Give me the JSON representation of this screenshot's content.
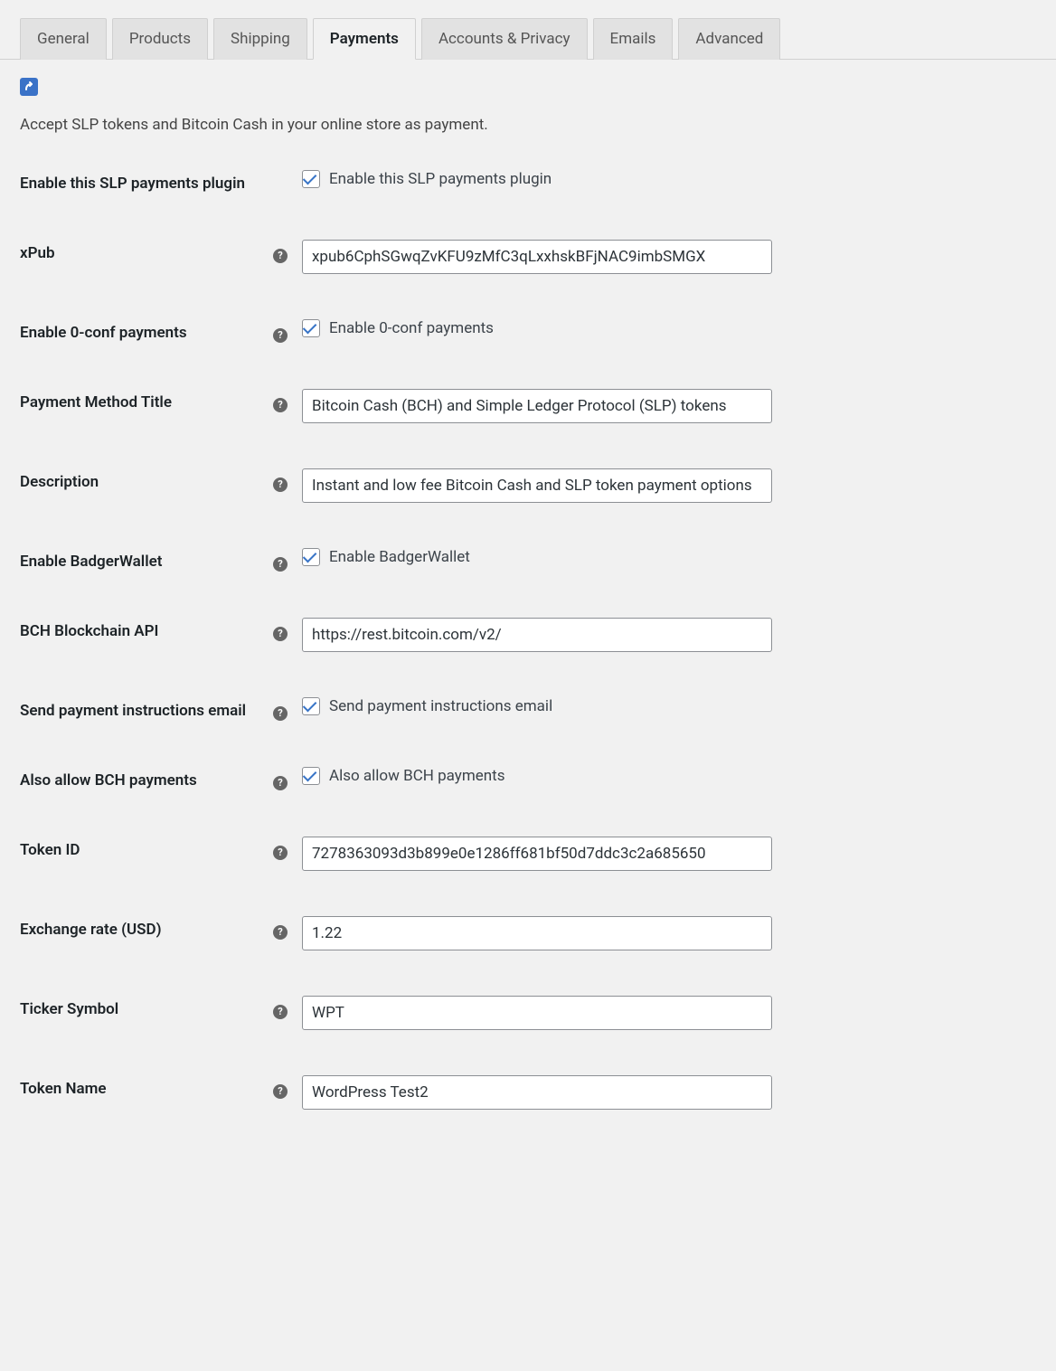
{
  "tabs": {
    "general": "General",
    "products": "Products",
    "shipping": "Shipping",
    "payments": "Payments",
    "accounts_privacy": "Accounts & Privacy",
    "emails": "Emails",
    "advanced": "Advanced"
  },
  "intro": "Accept SLP tokens and Bitcoin Cash in your online store as payment.",
  "fields": {
    "enable_plugin": {
      "label": "Enable this SLP payments plugin",
      "checkbox_label": "Enable this SLP payments plugin",
      "checked": true
    },
    "xpub": {
      "label": "xPub",
      "value": "xpub6CphSGwqZvKFU9zMfC3qLxxhskBFjNAC9imbSMGX"
    },
    "enable_0conf": {
      "label": "Enable 0-conf payments",
      "checkbox_label": "Enable 0-conf payments",
      "checked": true
    },
    "payment_method_title": {
      "label": "Payment Method Title",
      "value": "Bitcoin Cash (BCH) and Simple Ledger Protocol (SLP) tokens"
    },
    "description": {
      "label": "Description",
      "value": "Instant and low fee Bitcoin Cash and SLP token payment options"
    },
    "enable_badger": {
      "label": "Enable BadgerWallet",
      "checkbox_label": "Enable BadgerWallet",
      "checked": true
    },
    "bch_api": {
      "label": "BCH Blockchain API",
      "value": "https://rest.bitcoin.com/v2/"
    },
    "send_email": {
      "label": "Send payment instructions email",
      "checkbox_label": "Send payment instructions email",
      "checked": true
    },
    "allow_bch": {
      "label": "Also allow BCH payments",
      "checkbox_label": "Also allow BCH payments",
      "checked": true
    },
    "token_id": {
      "label": "Token ID",
      "value": "7278363093d3b899e0e1286ff681bf50d7ddc3c2a685650"
    },
    "exchange_rate": {
      "label": "Exchange rate (USD)",
      "value": "1.22"
    },
    "ticker": {
      "label": "Ticker Symbol",
      "value": "WPT"
    },
    "token_name": {
      "label": "Token Name",
      "value": "WordPress Test2"
    }
  }
}
